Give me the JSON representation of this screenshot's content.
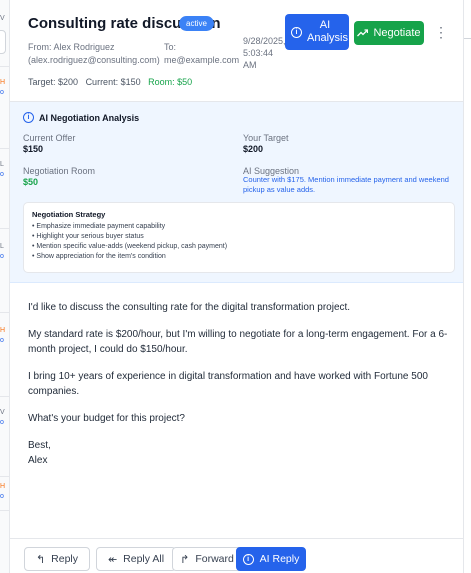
{
  "email": {
    "subject": "Consulting rate discussion",
    "status": "active",
    "from_label": "From: Alex Rodriguez",
    "from_email": "(alex.rodriguez@consulting.com)",
    "to_label": "To:",
    "to_email": "me@example.com",
    "date_line1": "9/28/2025,",
    "date_line2": "5:03:44",
    "date_line3": "AM",
    "target": "Target: $200",
    "current": "Current: $150",
    "room": "Room: $50"
  },
  "actions": {
    "ai_analysis_label": "AI Analysis",
    "negotiate_label": "Negotiate",
    "more_glyph": "⋮"
  },
  "analysis": {
    "title": "AI Negotiation Analysis",
    "current_offer_label": "Current Offer",
    "current_offer_value": "$150",
    "your_target_label": "Your Target",
    "your_target_value": "$200",
    "negotiation_room_label": "Negotiation Room",
    "negotiation_room_value": "$50",
    "ai_suggestion_label": "AI Suggestion",
    "ai_suggestion_text": "Counter with $175. Mention immediate payment and weekend pickup as value adds.",
    "strategy_title": "Negotiation Strategy",
    "strategy_items": [
      "• Emphasize immediate payment capability",
      "• Highlight your serious buyer status",
      "• Mention specific value-adds (weekend pickup, cash payment)",
      "• Show appreciation for the item's condition"
    ]
  },
  "body": {
    "paragraphs": [
      "I'd like to discuss the consulting rate for the digital transformation project.",
      "My standard rate is $200/hour, but I'm willing to negotiate for a long-term engagement. For a 6-month project, I could do $150/hour.",
      "I bring 10+ years of experience in digital transformation and have worked with Fortune 500 companies.",
      "What's your budget for this project?"
    ],
    "signoff": "Best,",
    "signature": "Alex"
  },
  "footer": {
    "reply_label": "Reply",
    "reply_all_label": "Reply All",
    "forward_label": "Forward",
    "ai_reply_label": "AI Reply"
  },
  "left_list": {
    "fragments": [
      "V",
      "H",
      "o",
      "L",
      "o",
      "L",
      "o",
      "H",
      "o",
      "V",
      "o",
      "H",
      "o"
    ]
  },
  "colors": {
    "primary": "#2563eb",
    "success": "#16a34a",
    "badge": "#3b82f6",
    "panel": "#eff6ff",
    "flag": "#f97316"
  },
  "icons": {
    "info": "info-icon",
    "trend": "trending-up-icon",
    "more": "more-vertical-icon",
    "reply": "reply-icon",
    "reply_all": "reply-all-icon",
    "forward": "forward-icon"
  }
}
